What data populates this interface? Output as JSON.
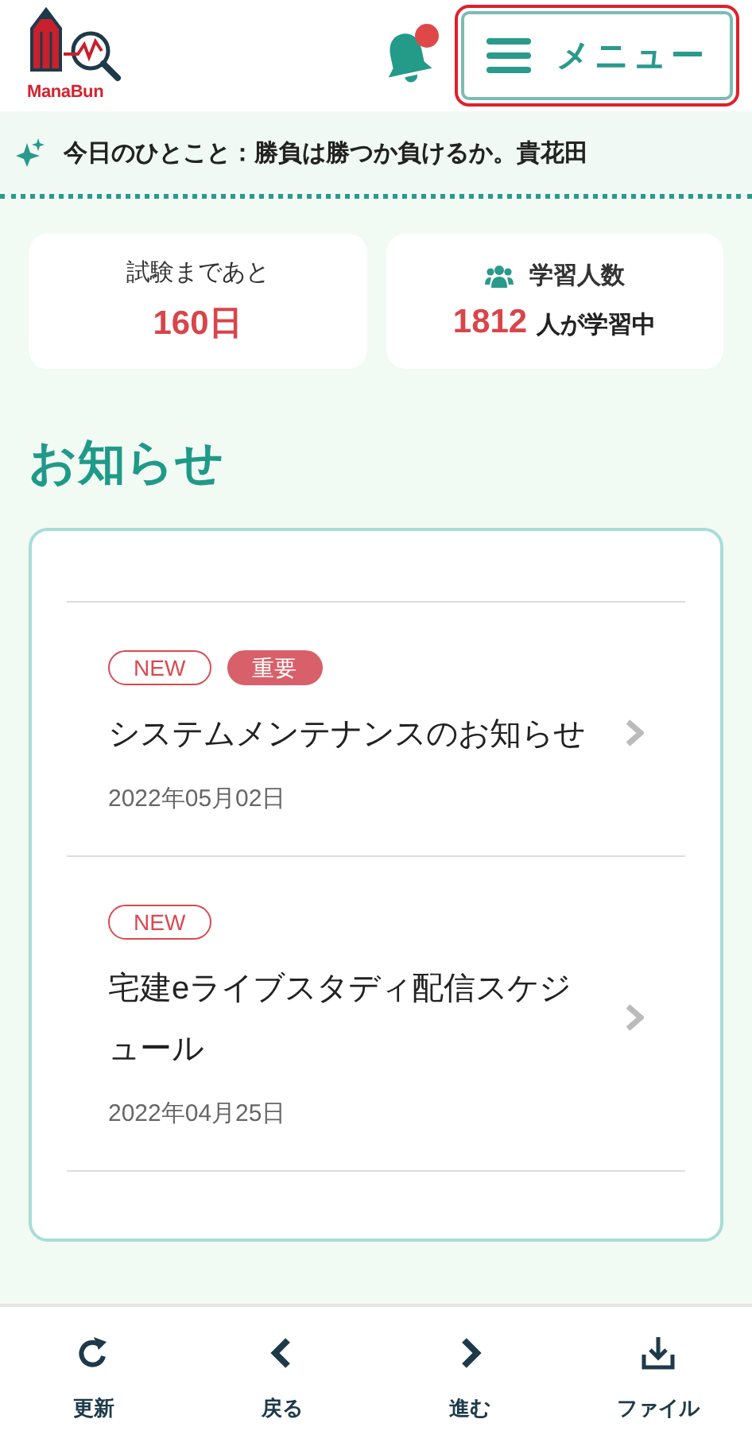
{
  "header": {
    "logo_text": "ManaBun",
    "bell": {
      "has_notification": true
    },
    "menu": {
      "label": "メニュー",
      "highlighted": true
    }
  },
  "quote": {
    "text": "今日のひとこと：勝負は勝つか負けるか。貴花田"
  },
  "stats": [
    {
      "kind": "countdown",
      "label": "試験まであと",
      "value": "160日"
    },
    {
      "kind": "learners",
      "label": "学習人数",
      "value": "1812",
      "suffix": "人が学習中"
    }
  ],
  "news": {
    "heading": "お知らせ",
    "items": [
      {
        "tags": [
          {
            "kind": "new",
            "label": "NEW"
          },
          {
            "kind": "important",
            "label": "重要"
          }
        ],
        "title": "システムメンテナンスのお知らせ",
        "date": "2022年05月02日"
      },
      {
        "tags": [
          {
            "kind": "new",
            "label": "NEW"
          }
        ],
        "title": "宅建eライブスタディ配信スケジュール",
        "date": "2022年04月25日"
      }
    ]
  },
  "bottom_nav": [
    {
      "kind": "refresh",
      "label": "更新"
    },
    {
      "kind": "back",
      "label": "戻る"
    },
    {
      "kind": "forward",
      "label": "進む"
    },
    {
      "kind": "file",
      "label": "ファイル"
    }
  ]
}
